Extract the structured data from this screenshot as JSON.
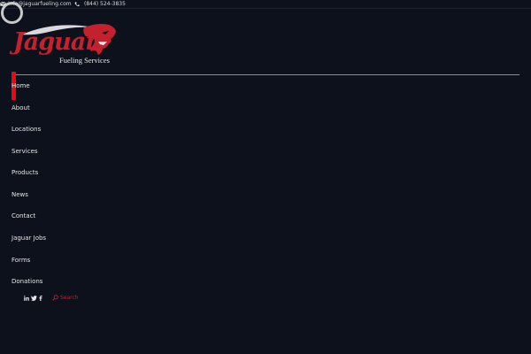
{
  "topbar": {
    "email": "info@jaguarfueling.com",
    "phone": "(844) 524-3835",
    "email_icon": "envelope-icon",
    "phone_icon": "phone-icon"
  },
  "logo": {
    "wordmark": "Jaguar",
    "tagline": "Fueling Services",
    "brand_color": "#c3212e"
  },
  "nav": {
    "active_index": 0,
    "items": [
      {
        "label": "Home"
      },
      {
        "label": "About"
      },
      {
        "label": "Locations"
      },
      {
        "label": "Services"
      },
      {
        "label": "Products"
      },
      {
        "label": "News"
      },
      {
        "label": "Contact"
      },
      {
        "label": "Jaguar Jobs"
      },
      {
        "label": "Forms"
      },
      {
        "label": "Donations"
      }
    ]
  },
  "social": {
    "icons": [
      "linkedin-icon",
      "twitter-icon",
      "facebook-icon"
    ]
  },
  "search": {
    "label": "Search"
  },
  "colors": {
    "background": "#0c111c",
    "accent": "#e00d19",
    "text": "#e6e6e6"
  }
}
